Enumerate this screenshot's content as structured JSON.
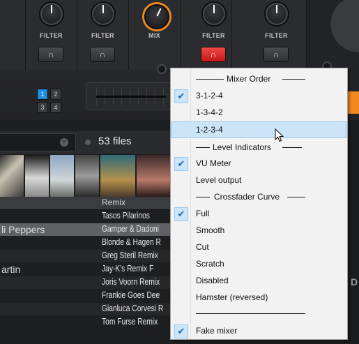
{
  "mixer": {
    "knobs": [
      {
        "label": "FILTER",
        "headphone_active": false
      },
      {
        "label": "FILTER",
        "headphone_active": false
      },
      {
        "label": "MIX",
        "headphone_active": null
      },
      {
        "label": "FILTER",
        "headphone_active": true
      },
      {
        "label": "FILTER",
        "headphone_active": false
      }
    ],
    "deck_buttons": [
      "1",
      "2",
      "3",
      "4"
    ],
    "accent": "#f08a1e",
    "headphone_active_color": "#e02424",
    "deck_button_active_color": "#1f8de0"
  },
  "browser": {
    "file_count": "53 files",
    "column_header": "Remix",
    "rows": [
      {
        "artist": "",
        "remix": "Tasos Pilarinos"
      },
      {
        "artist": "li Peppers",
        "remix": "Gamper & Dadoni",
        "selected": true
      },
      {
        "artist": "",
        "remix": "Blonde & Hagen R"
      },
      {
        "artist": "",
        "remix": "Greg Steril Remix"
      },
      {
        "artist": "artin",
        "remix": "Jay-K's Remix F"
      },
      {
        "artist": "",
        "remix": "Joris Voorn Remix"
      },
      {
        "artist": "",
        "remix": "Frankie Goes Dee"
      },
      {
        "artist": "",
        "remix": "Gianluca Corvesi R"
      },
      {
        "artist": "",
        "remix": "Tom Furse Remix"
      }
    ],
    "side_letter": "D"
  },
  "context_menu": {
    "sections": [
      {
        "header": "Mixer Order",
        "items": [
          {
            "label": "3-1-2-4",
            "checked": true
          },
          {
            "label": "1-3-4-2",
            "checked": false
          },
          {
            "label": "1-2-3-4",
            "checked": false,
            "hover": true
          }
        ]
      },
      {
        "header": "Level Indicators",
        "items": [
          {
            "label": "VU Meter",
            "checked": true
          },
          {
            "label": "Level output",
            "checked": false
          }
        ]
      },
      {
        "header": "Crossfader Curve",
        "items": [
          {
            "label": "Full",
            "checked": true
          },
          {
            "label": "Smooth",
            "checked": false
          },
          {
            "label": "Cut",
            "checked": false
          },
          {
            "label": "Scratch",
            "checked": false
          },
          {
            "label": "Disabled",
            "checked": false
          },
          {
            "label": "Hamster (reversed)",
            "checked": false
          }
        ]
      }
    ],
    "footer_item": {
      "label": "Fake mixer",
      "checked": true
    },
    "check_glyph": "✔"
  }
}
